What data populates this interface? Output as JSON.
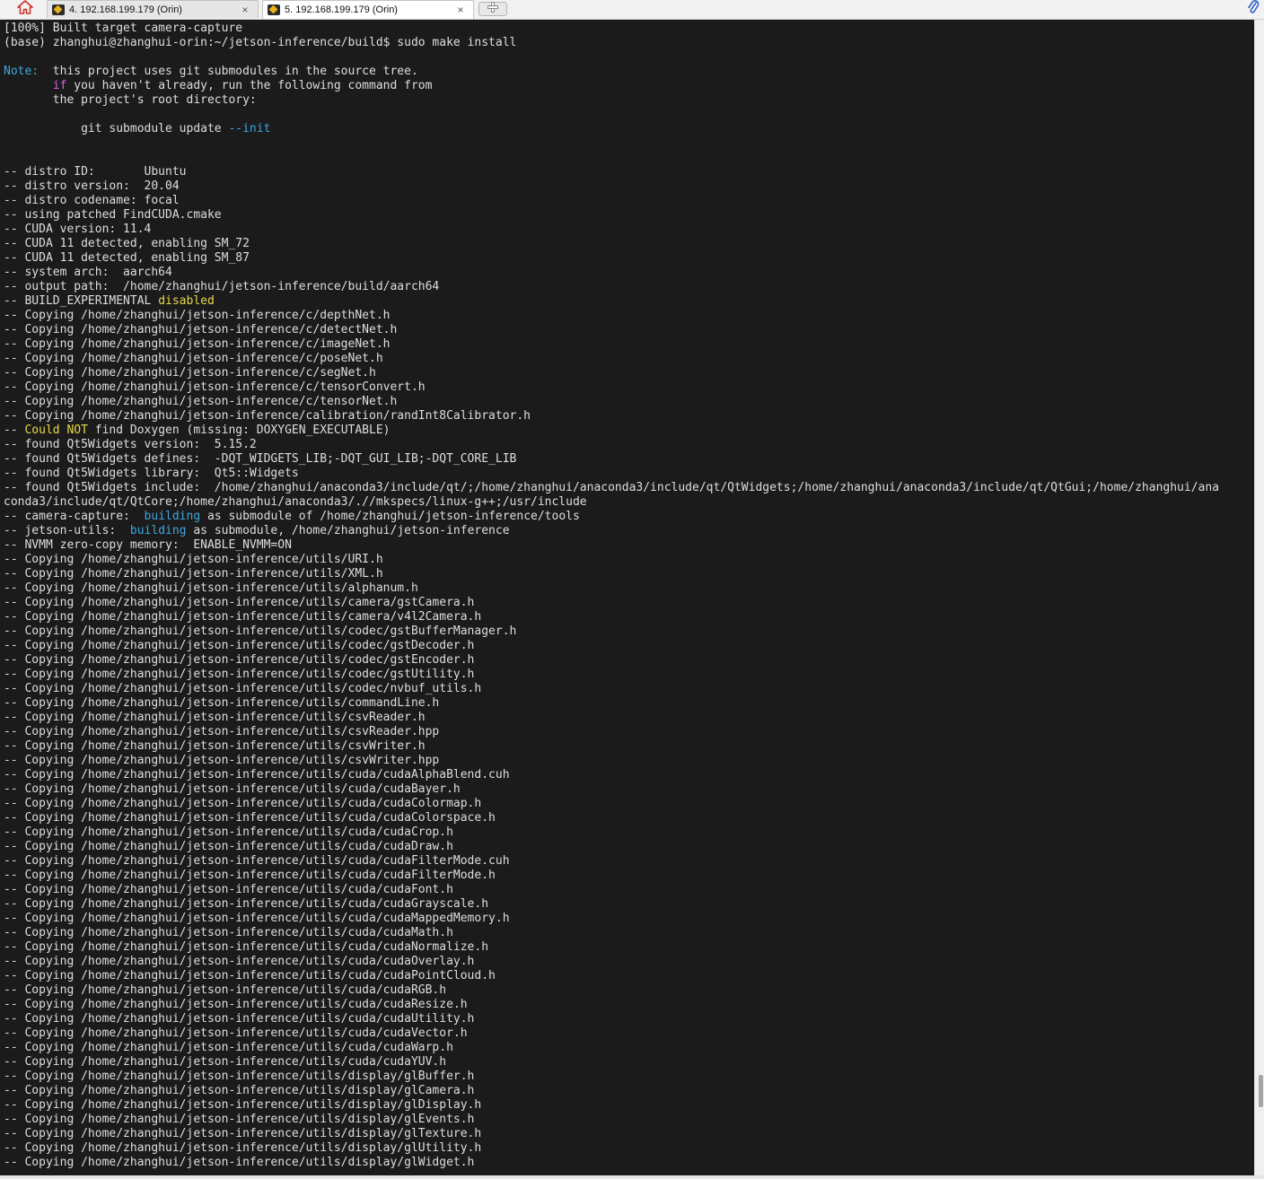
{
  "tabs": [
    {
      "label": "4. 192.168.199.179 (Orin)",
      "close": "×",
      "active": false
    },
    {
      "label": "5. 192.168.199.179 (Orin)",
      "close": "×",
      "active": true
    }
  ],
  "icons": {
    "home": "home-icon",
    "tab": "ssh-session-icon",
    "new_tab": "add-tab-icon",
    "attach": "paperclip-icon"
  },
  "colors": {
    "background": "#1b1b1b",
    "text": "#dedede",
    "cyan": "#3ea7e0",
    "magenta": "#d85ed8",
    "yellow": "#e6d94a"
  },
  "terminal": {
    "lines": [
      [
        {
          "t": "[100%] Built target camera-capture"
        }
      ],
      [
        {
          "t": "(base) zhanghui@zhanghui-orin:~/jetson-inference/build$ sudo make install"
        }
      ],
      [
        {
          "t": ""
        }
      ],
      [
        {
          "t": "Note:",
          "c": "cyan"
        },
        {
          "t": "  this project uses git submodules in the source tree."
        }
      ],
      [
        {
          "t": "       "
        },
        {
          "t": "if",
          "c": "magenta"
        },
        {
          "t": " you haven't already, run the following command from"
        }
      ],
      [
        {
          "t": "       the project's root directory:"
        }
      ],
      [
        {
          "t": ""
        }
      ],
      [
        {
          "t": "           git submodule update "
        },
        {
          "t": "--init",
          "c": "cyan"
        }
      ],
      [
        {
          "t": ""
        }
      ],
      [
        {
          "t": ""
        }
      ],
      [
        {
          "t": "-- distro ID:       Ubuntu"
        }
      ],
      [
        {
          "t": "-- distro version:  20.04"
        }
      ],
      [
        {
          "t": "-- distro codename: focal"
        }
      ],
      [
        {
          "t": "-- using patched FindCUDA.cmake"
        }
      ],
      [
        {
          "t": "-- CUDA version: 11.4"
        }
      ],
      [
        {
          "t": "-- CUDA 11 detected, enabling SM_72"
        }
      ],
      [
        {
          "t": "-- CUDA 11 detected, enabling SM_87"
        }
      ],
      [
        {
          "t": "-- system arch:  aarch64"
        }
      ],
      [
        {
          "t": "-- output path:  /home/zhanghui/jetson-inference/build/aarch64"
        }
      ],
      [
        {
          "t": "-- BUILD_EXPERIMENTAL "
        },
        {
          "t": "disabled",
          "c": "yellow"
        }
      ],
      [
        {
          "t": "-- Copying /home/zhanghui/jetson-inference/c/depthNet.h"
        }
      ],
      [
        {
          "t": "-- Copying /home/zhanghui/jetson-inference/c/detectNet.h"
        }
      ],
      [
        {
          "t": "-- Copying /home/zhanghui/jetson-inference/c/imageNet.h"
        }
      ],
      [
        {
          "t": "-- Copying /home/zhanghui/jetson-inference/c/poseNet.h"
        }
      ],
      [
        {
          "t": "-- Copying /home/zhanghui/jetson-inference/c/segNet.h"
        }
      ],
      [
        {
          "t": "-- Copying /home/zhanghui/jetson-inference/c/tensorConvert.h"
        }
      ],
      [
        {
          "t": "-- Copying /home/zhanghui/jetson-inference/c/tensorNet.h"
        }
      ],
      [
        {
          "t": "-- Copying /home/zhanghui/jetson-inference/calibration/randInt8Calibrator.h"
        }
      ],
      [
        {
          "t": "-- "
        },
        {
          "t": "Could NOT",
          "c": "yellow"
        },
        {
          "t": " find Doxygen (missing: DOXYGEN_EXECUTABLE)"
        }
      ],
      [
        {
          "t": "-- found Qt5Widgets version:  5.15.2"
        }
      ],
      [
        {
          "t": "-- found Qt5Widgets defines:  -DQT_WIDGETS_LIB;-DQT_GUI_LIB;-DQT_CORE_LIB"
        }
      ],
      [
        {
          "t": "-- found Qt5Widgets library:  Qt5::Widgets"
        }
      ],
      [
        {
          "t": "-- found Qt5Widgets include:  /home/zhanghui/anaconda3/include/qt/;/home/zhanghui/anaconda3/include/qt/QtWidgets;/home/zhanghui/anaconda3/include/qt/QtGui;/home/zhanghui/ana"
        }
      ],
      [
        {
          "t": "conda3/include/qt/QtCore;/home/zhanghui/anaconda3/.//mkspecs/linux-g++;/usr/include"
        }
      ],
      [
        {
          "t": "-- camera-capture:  "
        },
        {
          "t": "building",
          "c": "cyan"
        },
        {
          "t": " as submodule of /home/zhanghui/jetson-inference/tools"
        }
      ],
      [
        {
          "t": "-- jetson-utils:  "
        },
        {
          "t": "building",
          "c": "cyan"
        },
        {
          "t": " as submodule, /home/zhanghui/jetson-inference"
        }
      ],
      [
        {
          "t": "-- NVMM zero-copy memory:  ENABLE_NVMM=ON"
        }
      ],
      [
        {
          "t": "-- Copying /home/zhanghui/jetson-inference/utils/URI.h"
        }
      ],
      [
        {
          "t": "-- Copying /home/zhanghui/jetson-inference/utils/XML.h"
        }
      ],
      [
        {
          "t": "-- Copying /home/zhanghui/jetson-inference/utils/alphanum.h"
        }
      ],
      [
        {
          "t": "-- Copying /home/zhanghui/jetson-inference/utils/camera/gstCamera.h"
        }
      ],
      [
        {
          "t": "-- Copying /home/zhanghui/jetson-inference/utils/camera/v4l2Camera.h"
        }
      ],
      [
        {
          "t": "-- Copying /home/zhanghui/jetson-inference/utils/codec/gstBufferManager.h"
        }
      ],
      [
        {
          "t": "-- Copying /home/zhanghui/jetson-inference/utils/codec/gstDecoder.h"
        }
      ],
      [
        {
          "t": "-- Copying /home/zhanghui/jetson-inference/utils/codec/gstEncoder.h"
        }
      ],
      [
        {
          "t": "-- Copying /home/zhanghui/jetson-inference/utils/codec/gstUtility.h"
        }
      ],
      [
        {
          "t": "-- Copying /home/zhanghui/jetson-inference/utils/codec/nvbuf_utils.h"
        }
      ],
      [
        {
          "t": "-- Copying /home/zhanghui/jetson-inference/utils/commandLine.h"
        }
      ],
      [
        {
          "t": "-- Copying /home/zhanghui/jetson-inference/utils/csvReader.h"
        }
      ],
      [
        {
          "t": "-- Copying /home/zhanghui/jetson-inference/utils/csvReader.hpp"
        }
      ],
      [
        {
          "t": "-- Copying /home/zhanghui/jetson-inference/utils/csvWriter.h"
        }
      ],
      [
        {
          "t": "-- Copying /home/zhanghui/jetson-inference/utils/csvWriter.hpp"
        }
      ],
      [
        {
          "t": "-- Copying /home/zhanghui/jetson-inference/utils/cuda/cudaAlphaBlend.cuh"
        }
      ],
      [
        {
          "t": "-- Copying /home/zhanghui/jetson-inference/utils/cuda/cudaBayer.h"
        }
      ],
      [
        {
          "t": "-- Copying /home/zhanghui/jetson-inference/utils/cuda/cudaColormap.h"
        }
      ],
      [
        {
          "t": "-- Copying /home/zhanghui/jetson-inference/utils/cuda/cudaColorspace.h"
        }
      ],
      [
        {
          "t": "-- Copying /home/zhanghui/jetson-inference/utils/cuda/cudaCrop.h"
        }
      ],
      [
        {
          "t": "-- Copying /home/zhanghui/jetson-inference/utils/cuda/cudaDraw.h"
        }
      ],
      [
        {
          "t": "-- Copying /home/zhanghui/jetson-inference/utils/cuda/cudaFilterMode.cuh"
        }
      ],
      [
        {
          "t": "-- Copying /home/zhanghui/jetson-inference/utils/cuda/cudaFilterMode.h"
        }
      ],
      [
        {
          "t": "-- Copying /home/zhanghui/jetson-inference/utils/cuda/cudaFont.h"
        }
      ],
      [
        {
          "t": "-- Copying /home/zhanghui/jetson-inference/utils/cuda/cudaGrayscale.h"
        }
      ],
      [
        {
          "t": "-- Copying /home/zhanghui/jetson-inference/utils/cuda/cudaMappedMemory.h"
        }
      ],
      [
        {
          "t": "-- Copying /home/zhanghui/jetson-inference/utils/cuda/cudaMath.h"
        }
      ],
      [
        {
          "t": "-- Copying /home/zhanghui/jetson-inference/utils/cuda/cudaNormalize.h"
        }
      ],
      [
        {
          "t": "-- Copying /home/zhanghui/jetson-inference/utils/cuda/cudaOverlay.h"
        }
      ],
      [
        {
          "t": "-- Copying /home/zhanghui/jetson-inference/utils/cuda/cudaPointCloud.h"
        }
      ],
      [
        {
          "t": "-- Copying /home/zhanghui/jetson-inference/utils/cuda/cudaRGB.h"
        }
      ],
      [
        {
          "t": "-- Copying /home/zhanghui/jetson-inference/utils/cuda/cudaResize.h"
        }
      ],
      [
        {
          "t": "-- Copying /home/zhanghui/jetson-inference/utils/cuda/cudaUtility.h"
        }
      ],
      [
        {
          "t": "-- Copying /home/zhanghui/jetson-inference/utils/cuda/cudaVector.h"
        }
      ],
      [
        {
          "t": "-- Copying /home/zhanghui/jetson-inference/utils/cuda/cudaWarp.h"
        }
      ],
      [
        {
          "t": "-- Copying /home/zhanghui/jetson-inference/utils/cuda/cudaYUV.h"
        }
      ],
      [
        {
          "t": "-- Copying /home/zhanghui/jetson-inference/utils/display/glBuffer.h"
        }
      ],
      [
        {
          "t": "-- Copying /home/zhanghui/jetson-inference/utils/display/glCamera.h"
        }
      ],
      [
        {
          "t": "-- Copying /home/zhanghui/jetson-inference/utils/display/glDisplay.h"
        }
      ],
      [
        {
          "t": "-- Copying /home/zhanghui/jetson-inference/utils/display/glEvents.h"
        }
      ],
      [
        {
          "t": "-- Copying /home/zhanghui/jetson-inference/utils/display/glTexture.h"
        }
      ],
      [
        {
          "t": "-- Copying /home/zhanghui/jetson-inference/utils/display/glUtility.h"
        }
      ],
      [
        {
          "t": "-- Copying /home/zhanghui/jetson-inference/utils/display/glWidget.h"
        }
      ]
    ]
  }
}
